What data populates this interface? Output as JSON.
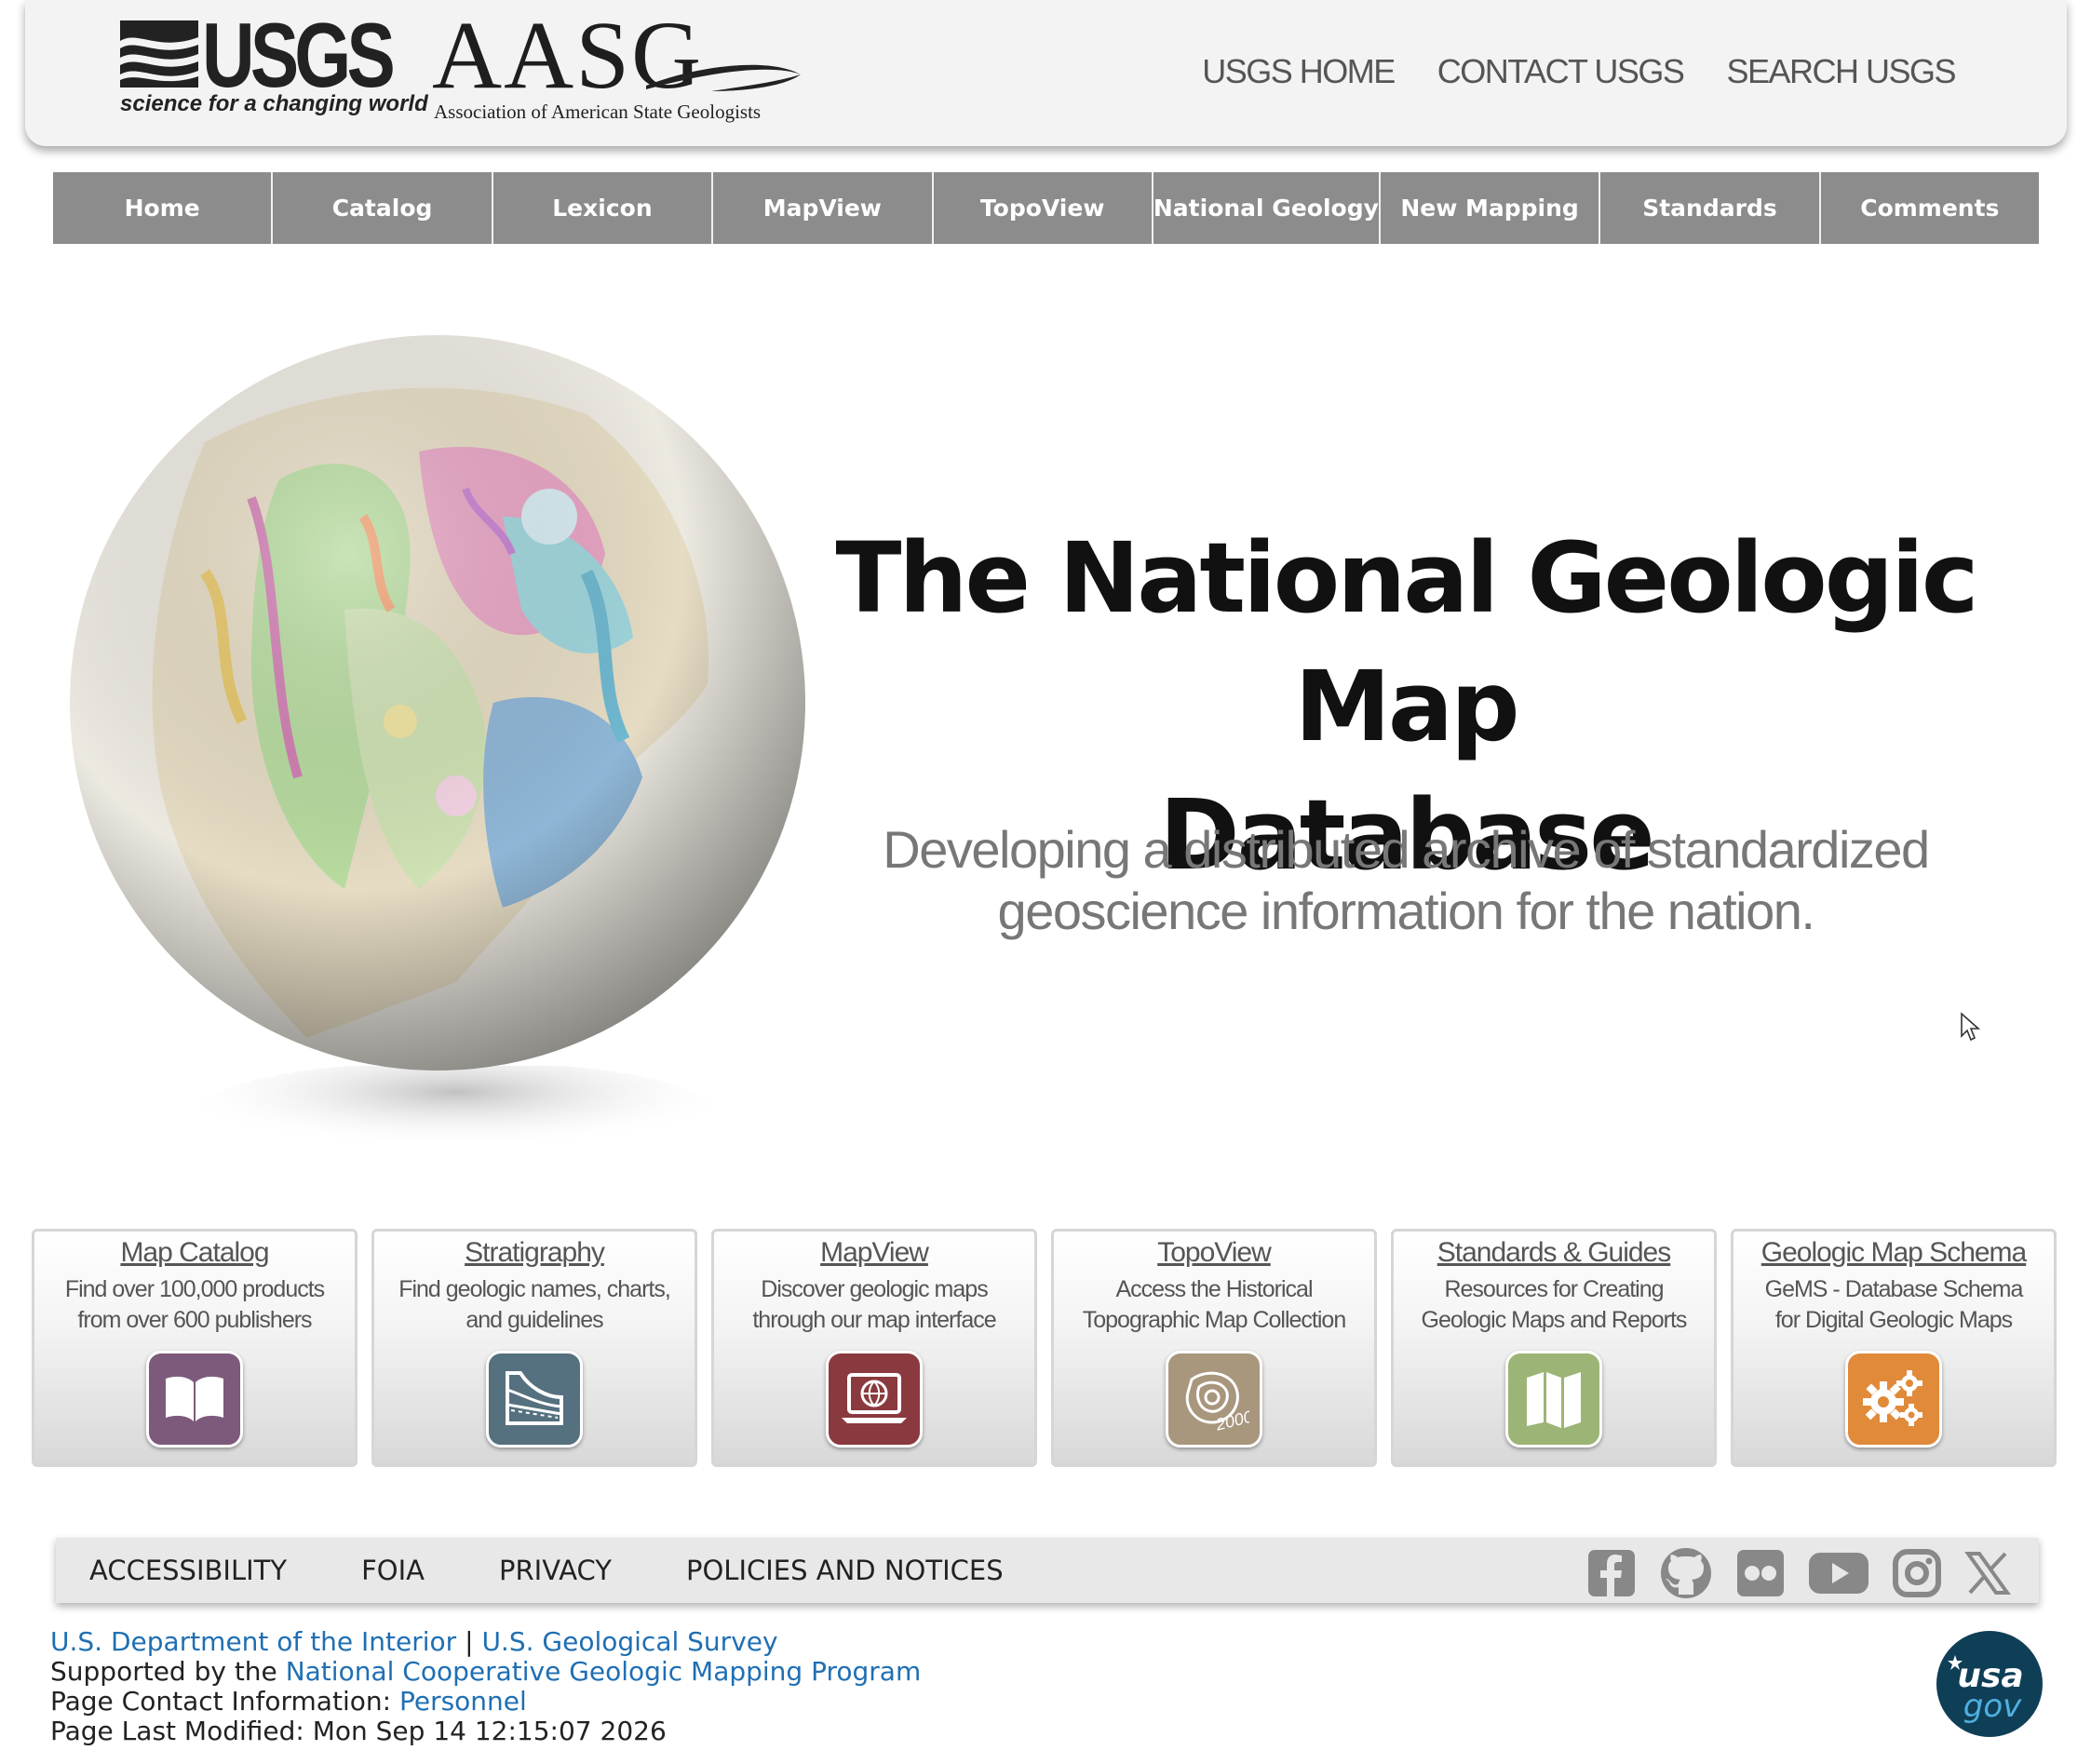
{
  "header": {
    "usgs_logo": {
      "word": "USGS",
      "tagline": "science for a changing world"
    },
    "aasg_logo": {
      "word": "AASG",
      "subtitle": "Association of American State Geologists"
    },
    "links": [
      "USGS HOME",
      "CONTACT USGS",
      "SEARCH USGS"
    ]
  },
  "nav": {
    "items": [
      "Home",
      "Catalog",
      "Lexicon",
      "MapView",
      "TopoView",
      "National Geology",
      "New Mapping",
      "Standards",
      "Comments"
    ],
    "colors": {
      "bar": "#8c8c8c",
      "text": "#ffffff"
    }
  },
  "hero": {
    "title_line1": "The National Geologic Map",
    "title_line2": "Database",
    "subtitle_line1": "Developing a distributed archive of standardized",
    "subtitle_line2": "geoscience information for the nation."
  },
  "cards": [
    {
      "title": "Map Catalog",
      "desc": "Find over 100,000 products\nfrom over 600 publishers",
      "icon": "book-icon",
      "color": "#7d5a7c"
    },
    {
      "title": "Stratigraphy",
      "desc": "Find geologic names, charts,\nand guidelines",
      "icon": "strata-icon",
      "color": "#55707f"
    },
    {
      "title": "MapView",
      "desc": "Discover geologic maps\nthrough our map interface",
      "icon": "laptop-globe-icon",
      "color": "#8a3a3e"
    },
    {
      "title": "TopoView",
      "desc": "Access the Historical\nTopographic Map Collection",
      "icon": "topo-icon",
      "color": "#a8967d",
      "icon_text": "2000"
    },
    {
      "title": "Standards & Guides",
      "desc": "Resources for Creating\nGeologic Maps and Reports",
      "icon": "folded-map-icon",
      "color": "#9cb475"
    },
    {
      "title": "Geologic Map Schema",
      "desc": "GeMS - Database Schema\nfor Digital Geologic Maps",
      "icon": "gears-icon",
      "color": "#e08a3a"
    }
  ],
  "footer": {
    "links": [
      "ACCESSIBILITY",
      "FOIA",
      "PRIVACY",
      "POLICIES AND NOTICES"
    ],
    "social": [
      "facebook-icon",
      "github-icon",
      "flickr-icon",
      "youtube-icon",
      "instagram-icon",
      "x-icon"
    ],
    "doi": "U.S. Department of the Interior",
    "separator": "|",
    "usgs": "U.S. Geological Survey",
    "supported_by": "Supported by the",
    "program": "National Cooperative Geologic Mapping Program",
    "contact_label": "Page Contact Information:",
    "contact_link": "Personnel",
    "modified": "Page Last Modified: Mon Sep 14 12:15:07 2026",
    "usagov": {
      "line1": "usa",
      "line2": "gov"
    },
    "link_color": "#1f6fb3"
  }
}
